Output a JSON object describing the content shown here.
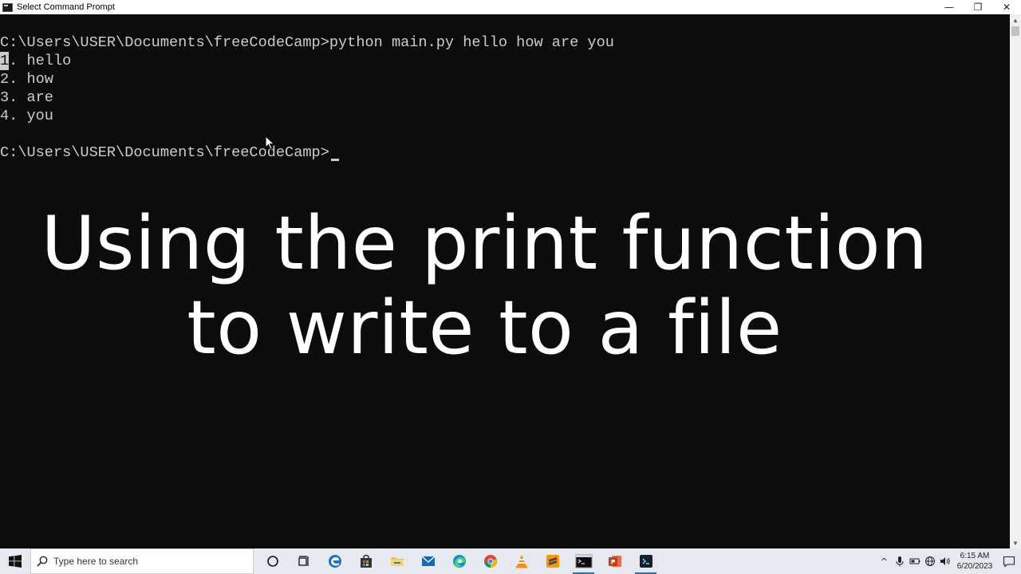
{
  "window": {
    "title": "Select Command Prompt",
    "controls": {
      "minimize": "—",
      "restore": "❐",
      "close": "✕"
    }
  },
  "console": {
    "lines": [
      "C:\\Users\\USER\\Documents\\freeCodeCamp>python main.py hello how are you",
      ". hello",
      "2. how",
      "3. are",
      "4. you",
      "",
      "C:\\Users\\USER\\Documents\\freeCodeCamp>"
    ],
    "selected_char": "1"
  },
  "overlay": {
    "line1": "Using the print function",
    "line2": "to write to a file"
  },
  "taskbar": {
    "search_placeholder": "Type here to search",
    "apps": [
      "cortana-icon",
      "task-view-icon",
      "edge-legacy-icon",
      "store-icon",
      "file-explorer-icon",
      "mail-icon",
      "edge-icon",
      "chrome-icon",
      "vlc-icon",
      "sublime-text-icon",
      "command-prompt-icon",
      "powerpoint-icon",
      "terminal-app-icon"
    ],
    "tray": {
      "chevron": "^",
      "time": "6:15 AM",
      "date": "6/20/2023"
    }
  },
  "colors": {
    "console_bg": "#0c0c0c",
    "console_text": "#cccccc",
    "overlay_text": "#ffffff",
    "taskbar_bg": "#e6eaf0"
  }
}
